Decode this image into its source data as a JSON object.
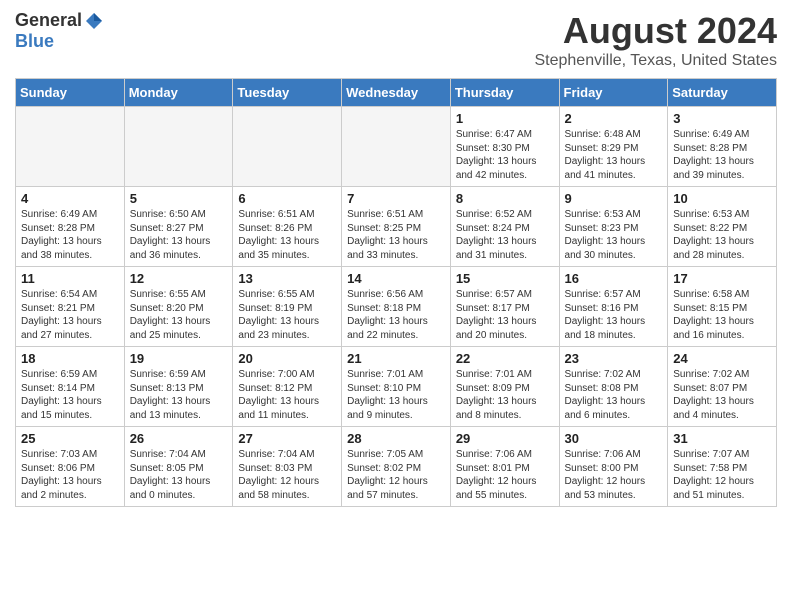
{
  "header": {
    "logo_general": "General",
    "logo_blue": "Blue",
    "month": "August 2024",
    "location": "Stephenville, Texas, United States"
  },
  "days_of_week": [
    "Sunday",
    "Monday",
    "Tuesday",
    "Wednesday",
    "Thursday",
    "Friday",
    "Saturday"
  ],
  "weeks": [
    [
      {
        "day": "",
        "info": ""
      },
      {
        "day": "",
        "info": ""
      },
      {
        "day": "",
        "info": ""
      },
      {
        "day": "",
        "info": ""
      },
      {
        "day": "1",
        "info": "Sunrise: 6:47 AM\nSunset: 8:30 PM\nDaylight: 13 hours\nand 42 minutes."
      },
      {
        "day": "2",
        "info": "Sunrise: 6:48 AM\nSunset: 8:29 PM\nDaylight: 13 hours\nand 41 minutes."
      },
      {
        "day": "3",
        "info": "Sunrise: 6:49 AM\nSunset: 8:28 PM\nDaylight: 13 hours\nand 39 minutes."
      }
    ],
    [
      {
        "day": "4",
        "info": "Sunrise: 6:49 AM\nSunset: 8:28 PM\nDaylight: 13 hours\nand 38 minutes."
      },
      {
        "day": "5",
        "info": "Sunrise: 6:50 AM\nSunset: 8:27 PM\nDaylight: 13 hours\nand 36 minutes."
      },
      {
        "day": "6",
        "info": "Sunrise: 6:51 AM\nSunset: 8:26 PM\nDaylight: 13 hours\nand 35 minutes."
      },
      {
        "day": "7",
        "info": "Sunrise: 6:51 AM\nSunset: 8:25 PM\nDaylight: 13 hours\nand 33 minutes."
      },
      {
        "day": "8",
        "info": "Sunrise: 6:52 AM\nSunset: 8:24 PM\nDaylight: 13 hours\nand 31 minutes."
      },
      {
        "day": "9",
        "info": "Sunrise: 6:53 AM\nSunset: 8:23 PM\nDaylight: 13 hours\nand 30 minutes."
      },
      {
        "day": "10",
        "info": "Sunrise: 6:53 AM\nSunset: 8:22 PM\nDaylight: 13 hours\nand 28 minutes."
      }
    ],
    [
      {
        "day": "11",
        "info": "Sunrise: 6:54 AM\nSunset: 8:21 PM\nDaylight: 13 hours\nand 27 minutes."
      },
      {
        "day": "12",
        "info": "Sunrise: 6:55 AM\nSunset: 8:20 PM\nDaylight: 13 hours\nand 25 minutes."
      },
      {
        "day": "13",
        "info": "Sunrise: 6:55 AM\nSunset: 8:19 PM\nDaylight: 13 hours\nand 23 minutes."
      },
      {
        "day": "14",
        "info": "Sunrise: 6:56 AM\nSunset: 8:18 PM\nDaylight: 13 hours\nand 22 minutes."
      },
      {
        "day": "15",
        "info": "Sunrise: 6:57 AM\nSunset: 8:17 PM\nDaylight: 13 hours\nand 20 minutes."
      },
      {
        "day": "16",
        "info": "Sunrise: 6:57 AM\nSunset: 8:16 PM\nDaylight: 13 hours\nand 18 minutes."
      },
      {
        "day": "17",
        "info": "Sunrise: 6:58 AM\nSunset: 8:15 PM\nDaylight: 13 hours\nand 16 minutes."
      }
    ],
    [
      {
        "day": "18",
        "info": "Sunrise: 6:59 AM\nSunset: 8:14 PM\nDaylight: 13 hours\nand 15 minutes."
      },
      {
        "day": "19",
        "info": "Sunrise: 6:59 AM\nSunset: 8:13 PM\nDaylight: 13 hours\nand 13 minutes."
      },
      {
        "day": "20",
        "info": "Sunrise: 7:00 AM\nSunset: 8:12 PM\nDaylight: 13 hours\nand 11 minutes."
      },
      {
        "day": "21",
        "info": "Sunrise: 7:01 AM\nSunset: 8:10 PM\nDaylight: 13 hours\nand 9 minutes."
      },
      {
        "day": "22",
        "info": "Sunrise: 7:01 AM\nSunset: 8:09 PM\nDaylight: 13 hours\nand 8 minutes."
      },
      {
        "day": "23",
        "info": "Sunrise: 7:02 AM\nSunset: 8:08 PM\nDaylight: 13 hours\nand 6 minutes."
      },
      {
        "day": "24",
        "info": "Sunrise: 7:02 AM\nSunset: 8:07 PM\nDaylight: 13 hours\nand 4 minutes."
      }
    ],
    [
      {
        "day": "25",
        "info": "Sunrise: 7:03 AM\nSunset: 8:06 PM\nDaylight: 13 hours\nand 2 minutes."
      },
      {
        "day": "26",
        "info": "Sunrise: 7:04 AM\nSunset: 8:05 PM\nDaylight: 13 hours\nand 0 minutes."
      },
      {
        "day": "27",
        "info": "Sunrise: 7:04 AM\nSunset: 8:03 PM\nDaylight: 12 hours\nand 58 minutes."
      },
      {
        "day": "28",
        "info": "Sunrise: 7:05 AM\nSunset: 8:02 PM\nDaylight: 12 hours\nand 57 minutes."
      },
      {
        "day": "29",
        "info": "Sunrise: 7:06 AM\nSunset: 8:01 PM\nDaylight: 12 hours\nand 55 minutes."
      },
      {
        "day": "30",
        "info": "Sunrise: 7:06 AM\nSunset: 8:00 PM\nDaylight: 12 hours\nand 53 minutes."
      },
      {
        "day": "31",
        "info": "Sunrise: 7:07 AM\nSunset: 7:58 PM\nDaylight: 12 hours\nand 51 minutes."
      }
    ]
  ]
}
